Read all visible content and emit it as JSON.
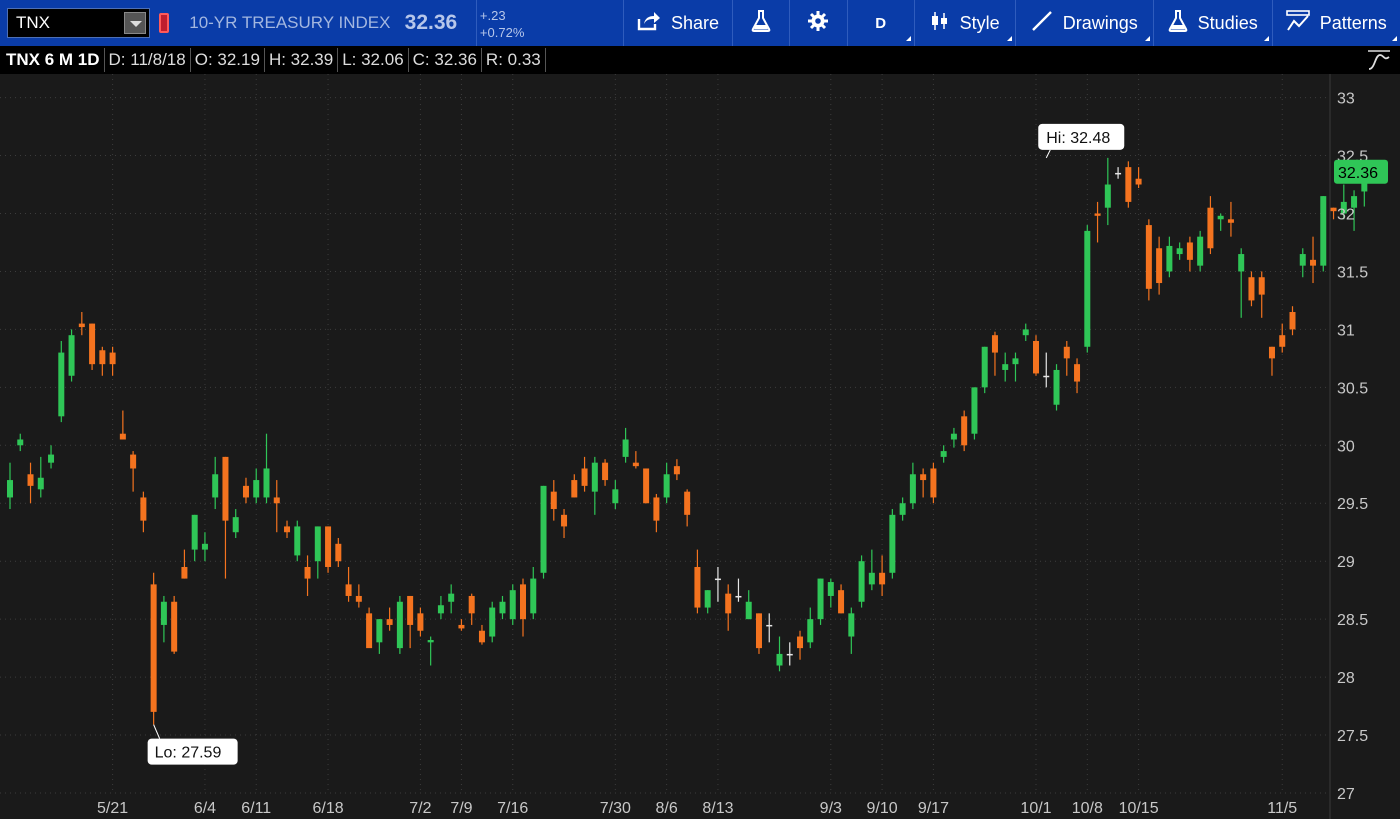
{
  "toolbar": {
    "symbol": "TNX",
    "index_name": "10-YR TREASURY INDEX",
    "last_price": "32.36",
    "change_abs": "+.23",
    "change_pct": "+0.72%",
    "share_label": "Share",
    "period_label": "D",
    "style_label": "Style",
    "drawings_label": "Drawings",
    "studies_label": "Studies",
    "patterns_label": "Patterns"
  },
  "infobar": {
    "symbol_period": "TNX 6 M 1D",
    "date": "D: 11/8/18",
    "open": "O: 32.19",
    "high": "H: 32.39",
    "low": "L: 32.06",
    "close": "C: 32.36",
    "range": "R: 0.33"
  },
  "colors": {
    "up": "#2fc657",
    "down": "#f4731f",
    "neutral": "#e6e6e6",
    "toolbar": "#0a3ca8",
    "background": "#1a1a1a",
    "last_price_tag": "#2fc657"
  },
  "chart_data": {
    "type": "candlestick",
    "ylim": [
      27,
      33.1
    ],
    "y_ticks": [
      "33",
      "32.5",
      "32",
      "31.5",
      "31",
      "30.5",
      "30",
      "29.5",
      "29",
      "28.5",
      "28",
      "27.5",
      "27"
    ],
    "x_labels": [
      {
        "label": "5/21",
        "index": 10
      },
      {
        "label": "6/4",
        "index": 19
      },
      {
        "label": "6/11",
        "index": 24
      },
      {
        "label": "6/18",
        "index": 31
      },
      {
        "label": "7/2",
        "index": 40
      },
      {
        "label": "7/9",
        "index": 44
      },
      {
        "label": "7/16",
        "index": 49
      },
      {
        "label": "7/30",
        "index": 59
      },
      {
        "label": "8/6",
        "index": 64
      },
      {
        "label": "8/13",
        "index": 69
      },
      {
        "label": "9/3",
        "index": 80
      },
      {
        "label": "9/10",
        "index": 85
      },
      {
        "label": "9/17",
        "index": 90
      },
      {
        "label": "10/1",
        "index": 100
      },
      {
        "label": "10/8",
        "index": 105
      },
      {
        "label": "10/15",
        "index": 110
      },
      {
        "label": "11/5",
        "index": 124
      }
    ],
    "high_label": "Hi: 32.48",
    "high_index": 101,
    "high_value": 32.48,
    "low_label": "Lo: 27.59",
    "low_index": 14,
    "low_value": 27.59,
    "last_label": "32.36",
    "last_value": 32.36,
    "candles": [
      {
        "o": 29.55,
        "h": 29.85,
        "l": 29.45,
        "c": 29.7
      },
      {
        "o": 30.0,
        "h": 30.1,
        "l": 29.95,
        "c": 30.05
      },
      {
        "o": 29.75,
        "h": 29.85,
        "l": 29.5,
        "c": 29.65
      },
      {
        "o": 29.62,
        "h": 29.9,
        "l": 29.55,
        "c": 29.72
      },
      {
        "o": 29.85,
        "h": 30.0,
        "l": 29.8,
        "c": 29.92
      },
      {
        "o": 30.25,
        "h": 30.9,
        "l": 30.2,
        "c": 30.8
      },
      {
        "o": 30.6,
        "h": 31.0,
        "l": 30.55,
        "c": 30.95
      },
      {
        "o": 31.05,
        "h": 31.15,
        "l": 30.95,
        "c": 31.02
      },
      {
        "o": 31.05,
        "h": 31.05,
        "l": 30.65,
        "c": 30.7
      },
      {
        "o": 30.82,
        "h": 30.85,
        "l": 30.6,
        "c": 30.7
      },
      {
        "o": 30.8,
        "h": 30.85,
        "l": 30.6,
        "c": 30.7
      },
      {
        "o": 30.1,
        "h": 30.3,
        "l": 30.05,
        "c": 30.05
      },
      {
        "o": 29.92,
        "h": 29.95,
        "l": 29.6,
        "c": 29.8
      },
      {
        "o": 29.55,
        "h": 29.6,
        "l": 29.25,
        "c": 29.35
      },
      {
        "o": 28.8,
        "h": 28.9,
        "l": 27.59,
        "c": 27.7
      },
      {
        "o": 28.45,
        "h": 28.7,
        "l": 28.3,
        "c": 28.65
      },
      {
        "o": 28.65,
        "h": 28.7,
        "l": 28.2,
        "c": 28.22
      },
      {
        "o": 28.95,
        "h": 29.1,
        "l": 28.85,
        "c": 28.85
      },
      {
        "o": 29.1,
        "h": 29.4,
        "l": 29.0,
        "c": 29.4
      },
      {
        "o": 29.1,
        "h": 29.25,
        "l": 29.0,
        "c": 29.15
      },
      {
        "o": 29.55,
        "h": 29.9,
        "l": 29.45,
        "c": 29.75
      },
      {
        "o": 29.9,
        "h": 29.9,
        "l": 28.85,
        "c": 29.35
      },
      {
        "o": 29.25,
        "h": 29.45,
        "l": 29.2,
        "c": 29.38
      },
      {
        "o": 29.65,
        "h": 29.72,
        "l": 29.5,
        "c": 29.55
      },
      {
        "o": 29.55,
        "h": 29.8,
        "l": 29.5,
        "c": 29.7
      },
      {
        "o": 29.55,
        "h": 30.1,
        "l": 29.5,
        "c": 29.8
      },
      {
        "o": 29.55,
        "h": 29.7,
        "l": 29.25,
        "c": 29.5
      },
      {
        "o": 29.3,
        "h": 29.35,
        "l": 29.2,
        "c": 29.25
      },
      {
        "o": 29.05,
        "h": 29.35,
        "l": 29.0,
        "c": 29.3
      },
      {
        "o": 28.95,
        "h": 29.05,
        "l": 28.7,
        "c": 28.85
      },
      {
        "o": 29.0,
        "h": 29.3,
        "l": 28.85,
        "c": 29.3
      },
      {
        "o": 29.3,
        "h": 29.3,
        "l": 28.9,
        "c": 28.95
      },
      {
        "o": 29.15,
        "h": 29.2,
        "l": 28.95,
        "c": 29.0
      },
      {
        "o": 28.8,
        "h": 28.95,
        "l": 28.65,
        "c": 28.7
      },
      {
        "o": 28.7,
        "h": 28.8,
        "l": 28.6,
        "c": 28.65
      },
      {
        "o": 28.55,
        "h": 28.6,
        "l": 28.3,
        "c": 28.25
      },
      {
        "o": 28.3,
        "h": 28.5,
        "l": 28.2,
        "c": 28.5
      },
      {
        "o": 28.5,
        "h": 28.6,
        "l": 28.4,
        "c": 28.45
      },
      {
        "o": 28.25,
        "h": 28.7,
        "l": 28.2,
        "c": 28.65
      },
      {
        "o": 28.7,
        "h": 28.7,
        "l": 28.25,
        "c": 28.45
      },
      {
        "o": 28.55,
        "h": 28.6,
        "l": 28.35,
        "c": 28.4
      },
      {
        "o": 28.3,
        "h": 28.35,
        "l": 28.1,
        "c": 28.32
      },
      {
        "o": 28.55,
        "h": 28.7,
        "l": 28.5,
        "c": 28.62
      },
      {
        "o": 28.65,
        "h": 28.8,
        "l": 28.55,
        "c": 28.72
      },
      {
        "o": 28.45,
        "h": 28.5,
        "l": 28.4,
        "c": 28.42
      },
      {
        "o": 28.7,
        "h": 28.72,
        "l": 28.45,
        "c": 28.55
      },
      {
        "o": 28.4,
        "h": 28.45,
        "l": 28.28,
        "c": 28.3
      },
      {
        "o": 28.35,
        "h": 28.65,
        "l": 28.3,
        "c": 28.6
      },
      {
        "o": 28.55,
        "h": 28.7,
        "l": 28.5,
        "c": 28.65
      },
      {
        "o": 28.5,
        "h": 28.8,
        "l": 28.45,
        "c": 28.75
      },
      {
        "o": 28.8,
        "h": 28.85,
        "l": 28.35,
        "c": 28.5
      },
      {
        "o": 28.55,
        "h": 28.95,
        "l": 28.5,
        "c": 28.85
      },
      {
        "o": 28.9,
        "h": 29.65,
        "l": 28.85,
        "c": 29.65
      },
      {
        "o": 29.6,
        "h": 29.7,
        "l": 29.35,
        "c": 29.45
      },
      {
        "o": 29.4,
        "h": 29.45,
        "l": 29.2,
        "c": 29.3
      },
      {
        "o": 29.7,
        "h": 29.75,
        "l": 29.55,
        "c": 29.55
      },
      {
        "o": 29.8,
        "h": 29.9,
        "l": 29.6,
        "c": 29.65
      },
      {
        "o": 29.6,
        "h": 29.9,
        "l": 29.4,
        "c": 29.85
      },
      {
        "o": 29.85,
        "h": 29.88,
        "l": 29.65,
        "c": 29.7
      },
      {
        "o": 29.5,
        "h": 29.7,
        "l": 29.45,
        "c": 29.62
      },
      {
        "o": 29.9,
        "h": 30.15,
        "l": 29.85,
        "c": 30.05
      },
      {
        "o": 29.85,
        "h": 29.95,
        "l": 29.8,
        "c": 29.82
      },
      {
        "o": 29.8,
        "h": 29.8,
        "l": 29.5,
        "c": 29.5
      },
      {
        "o": 29.55,
        "h": 29.58,
        "l": 29.25,
        "c": 29.35
      },
      {
        "o": 29.55,
        "h": 29.85,
        "l": 29.5,
        "c": 29.75
      },
      {
        "o": 29.82,
        "h": 29.88,
        "l": 29.7,
        "c": 29.75
      },
      {
        "o": 29.6,
        "h": 29.62,
        "l": 29.3,
        "c": 29.4
      },
      {
        "o": 28.95,
        "h": 29.1,
        "l": 28.55,
        "c": 28.6
      },
      {
        "o": 28.6,
        "h": 28.75,
        "l": 28.55,
        "c": 28.75
      },
      {
        "o": 28.85,
        "h": 28.95,
        "l": 28.65,
        "c": 28.85
      },
      {
        "o": 28.72,
        "h": 28.8,
        "l": 28.4,
        "c": 28.55
      },
      {
        "o": 28.7,
        "h": 28.85,
        "l": 28.65,
        "c": 28.7
      },
      {
        "o": 28.5,
        "h": 28.75,
        "l": 28.5,
        "c": 28.65
      },
      {
        "o": 28.55,
        "h": 28.55,
        "l": 28.2,
        "c": 28.25
      },
      {
        "o": 28.45,
        "h": 28.55,
        "l": 28.3,
        "c": 28.45
      },
      {
        "o": 28.1,
        "h": 28.35,
        "l": 28.05,
        "c": 28.2
      },
      {
        "o": 28.2,
        "h": 28.3,
        "l": 28.1,
        "c": 28.2
      },
      {
        "o": 28.35,
        "h": 28.4,
        "l": 28.15,
        "c": 28.25
      },
      {
        "o": 28.3,
        "h": 28.6,
        "l": 28.25,
        "c": 28.5
      },
      {
        "o": 28.5,
        "h": 28.85,
        "l": 28.45,
        "c": 28.85
      },
      {
        "o": 28.7,
        "h": 28.85,
        "l": 28.6,
        "c": 28.82
      },
      {
        "o": 28.75,
        "h": 28.8,
        "l": 28.55,
        "c": 28.55
      },
      {
        "o": 28.35,
        "h": 28.6,
        "l": 28.2,
        "c": 28.55
      },
      {
        "o": 28.65,
        "h": 29.05,
        "l": 28.6,
        "c": 29.0
      },
      {
        "o": 28.8,
        "h": 29.1,
        "l": 28.75,
        "c": 28.9
      },
      {
        "o": 28.9,
        "h": 29.05,
        "l": 28.7,
        "c": 28.8
      },
      {
        "o": 28.9,
        "h": 29.45,
        "l": 28.85,
        "c": 29.4
      },
      {
        "o": 29.4,
        "h": 29.55,
        "l": 29.35,
        "c": 29.5
      },
      {
        "o": 29.5,
        "h": 29.85,
        "l": 29.45,
        "c": 29.75
      },
      {
        "o": 29.75,
        "h": 29.8,
        "l": 29.55,
        "c": 29.7
      },
      {
        "o": 29.8,
        "h": 29.85,
        "l": 29.5,
        "c": 29.55
      },
      {
        "o": 29.9,
        "h": 30.0,
        "l": 29.85,
        "c": 29.95
      },
      {
        "o": 30.05,
        "h": 30.15,
        "l": 29.98,
        "c": 30.1
      },
      {
        "o": 30.25,
        "h": 30.3,
        "l": 29.95,
        "c": 30.0
      },
      {
        "o": 30.1,
        "h": 30.5,
        "l": 30.05,
        "c": 30.5
      },
      {
        "o": 30.5,
        "h": 30.85,
        "l": 30.45,
        "c": 30.85
      },
      {
        "o": 30.95,
        "h": 30.98,
        "l": 30.6,
        "c": 30.8
      },
      {
        "o": 30.65,
        "h": 30.8,
        "l": 30.55,
        "c": 30.7
      },
      {
        "o": 30.7,
        "h": 30.8,
        "l": 30.55,
        "c": 30.75
      },
      {
        "o": 30.95,
        "h": 31.05,
        "l": 30.9,
        "c": 31.0
      },
      {
        "o": 30.9,
        "h": 30.95,
        "l": 30.6,
        "c": 30.62
      },
      {
        "o": 30.6,
        "h": 30.8,
        "l": 30.5,
        "c": 30.6
      },
      {
        "o": 30.35,
        "h": 30.7,
        "l": 30.3,
        "c": 30.65
      },
      {
        "o": 30.85,
        "h": 30.9,
        "l": 30.6,
        "c": 30.75
      },
      {
        "o": 30.7,
        "h": 30.75,
        "l": 30.45,
        "c": 30.55
      },
      {
        "o": 30.85,
        "h": 31.9,
        "l": 30.8,
        "c": 31.85
      },
      {
        "o": 32.0,
        "h": 32.1,
        "l": 31.75,
        "c": 31.98
      },
      {
        "o": 32.05,
        "h": 32.48,
        "l": 31.9,
        "c": 32.25
      },
      {
        "o": 32.35,
        "h": 32.4,
        "l": 32.3,
        "c": 32.35
      },
      {
        "o": 32.4,
        "h": 32.45,
        "l": 32.05,
        "c": 32.1
      },
      {
        "o": 32.3,
        "h": 32.4,
        "l": 32.22,
        "c": 32.25
      },
      {
        "o": 31.9,
        "h": 31.95,
        "l": 31.25,
        "c": 31.35
      },
      {
        "o": 31.7,
        "h": 31.8,
        "l": 31.3,
        "c": 31.4
      },
      {
        "o": 31.5,
        "h": 31.8,
        "l": 31.45,
        "c": 31.72
      },
      {
        "o": 31.65,
        "h": 31.75,
        "l": 31.6,
        "c": 31.7
      },
      {
        "o": 31.75,
        "h": 31.8,
        "l": 31.5,
        "c": 31.6
      },
      {
        "o": 31.55,
        "h": 31.85,
        "l": 31.5,
        "c": 31.8
      },
      {
        "o": 32.05,
        "h": 32.15,
        "l": 31.65,
        "c": 31.7
      },
      {
        "o": 31.95,
        "h": 32.0,
        "l": 31.85,
        "c": 31.98
      },
      {
        "o": 31.95,
        "h": 32.1,
        "l": 31.8,
        "c": 31.92
      },
      {
        "o": 31.5,
        "h": 31.7,
        "l": 31.1,
        "c": 31.65
      },
      {
        "o": 31.45,
        "h": 31.5,
        "l": 31.2,
        "c": 31.25
      },
      {
        "o": 31.45,
        "h": 31.5,
        "l": 31.1,
        "c": 31.3
      },
      {
        "o": 30.85,
        "h": 30.85,
        "l": 30.6,
        "c": 30.75
      },
      {
        "o": 30.95,
        "h": 31.05,
        "l": 30.8,
        "c": 30.85
      },
      {
        "o": 31.15,
        "h": 31.2,
        "l": 30.95,
        "c": 31.0
      },
      {
        "o": 31.55,
        "h": 31.7,
        "l": 31.45,
        "c": 31.65
      },
      {
        "o": 31.6,
        "h": 31.8,
        "l": 31.4,
        "c": 31.55
      },
      {
        "o": 31.55,
        "h": 32.15,
        "l": 31.5,
        "c": 32.15
      },
      {
        "o": 32.05,
        "h": 32.05,
        "l": 31.95,
        "c": 32.02
      },
      {
        "o": 32.0,
        "h": 32.25,
        "l": 31.95,
        "c": 32.1
      },
      {
        "o": 32.05,
        "h": 32.2,
        "l": 31.85,
        "c": 32.15
      },
      {
        "o": 32.19,
        "h": 32.39,
        "l": 32.06,
        "c": 32.36
      }
    ]
  }
}
